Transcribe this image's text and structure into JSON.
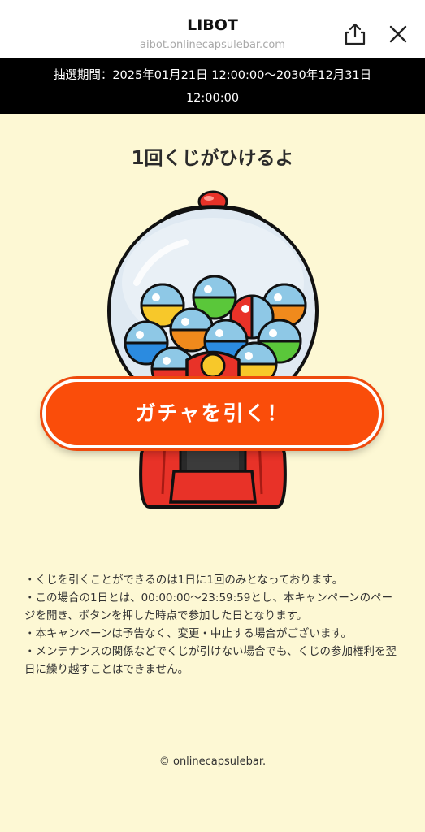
{
  "header": {
    "title": "LIBOT",
    "url": "aibot.onlinecapsulebar.com",
    "share_icon": "share-icon",
    "close_icon": "close-icon"
  },
  "period": {
    "line1": "抽選期間：2025年01月21日 12:00:00〜2030年12月31日",
    "line2": "12:00:00"
  },
  "lead_text": "1回くじがひけるよ",
  "gacha_button_label": "ガチャを引く！",
  "notes": [
    "・くじを引くことができるのは1日に1回のみとなっております。",
    "・この場合の1日とは、00:00:00〜23:59:59とし、本キャンペーンのページを開き、ボタンを押した時点で参加した日となります。",
    "・本キャンペーンは予告なく、変更・中止する場合がございます。",
    "・メンテナンスの関係などでくじが引けない場合でも、くじの参加権利を翌日に繰り越すことはできません。"
  ],
  "footer": "© onlinecapsulebar.",
  "colors": {
    "background": "#fdf8d4",
    "button": "#fa4d0a",
    "machine_red": "#e83228"
  }
}
